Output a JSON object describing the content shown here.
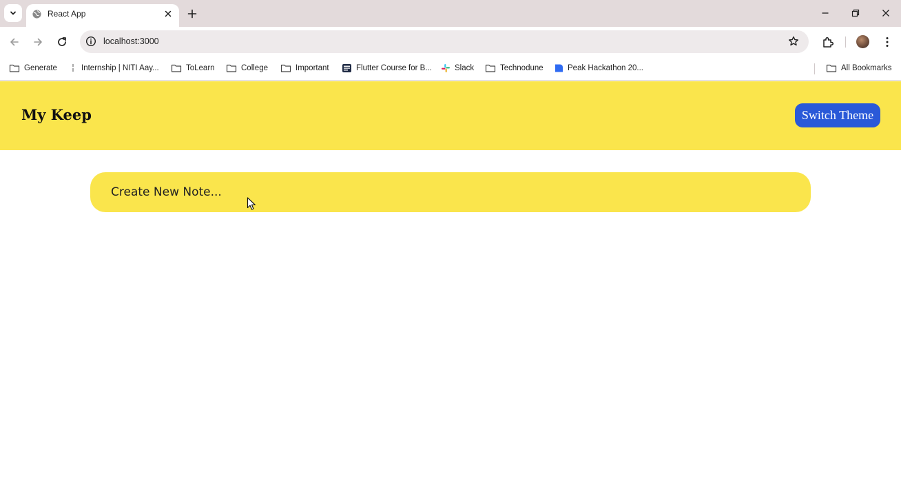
{
  "browser": {
    "tab": {
      "title": "React App"
    },
    "omnibox": {
      "url": "localhost:3000"
    },
    "bookmarks": [
      {
        "label": "Generate",
        "icon": "folder-icon"
      },
      {
        "label": "Internship | NITI Aay...",
        "icon": "bookmark-favicon-icon"
      },
      {
        "label": "ToLearn",
        "icon": "folder-icon"
      },
      {
        "label": "College",
        "icon": "folder-icon"
      },
      {
        "label": "Important",
        "icon": "folder-icon"
      },
      {
        "label": "Flutter Course for B...",
        "icon": "course-favicon-icon"
      },
      {
        "label": "Slack",
        "icon": "slack-icon"
      },
      {
        "label": "Technodune",
        "icon": "folder-icon"
      },
      {
        "label": "Peak Hackathon 20...",
        "icon": "hackathon-favicon-icon"
      }
    ],
    "all_bookmarks": "All Bookmarks"
  },
  "app": {
    "title": "My Keep",
    "switch_theme": "Switch Theme",
    "note_placeholder": "Create New Note..."
  },
  "colors": {
    "header": "#fae54c",
    "note_input": "#fae54c",
    "button": "#2a59d8",
    "tabstrip": "#e3dadb"
  }
}
